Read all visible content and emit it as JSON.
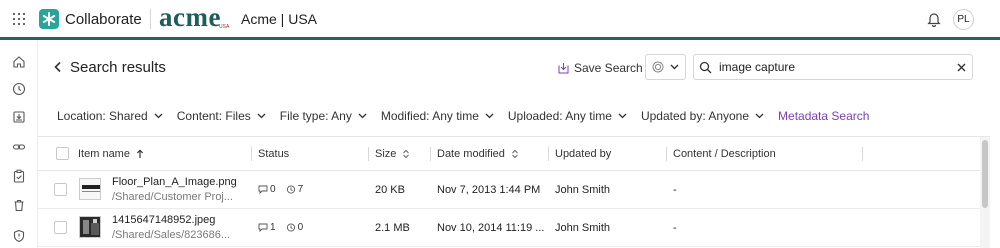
{
  "app": {
    "name": "Collaborate",
    "org_logo_text": "acme",
    "org_logo_sub": "USA",
    "org_name": "Acme | USA"
  },
  "user": {
    "initials": "PL"
  },
  "page": {
    "title": "Search results"
  },
  "toolbar": {
    "save_search_label": "Save Search"
  },
  "search": {
    "value": "image capture",
    "placeholder": ""
  },
  "filters": [
    {
      "label": "Location: Shared"
    },
    {
      "label": "Content: Files"
    },
    {
      "label": "File type: Any"
    },
    {
      "label": "Modified: Any time"
    },
    {
      "label": "Uploaded: Any time"
    },
    {
      "label": "Updated by: Anyone"
    }
  ],
  "metadata_search_label": "Metadata Search",
  "table": {
    "columns": {
      "name": "Item name",
      "status": "Status",
      "size": "Size",
      "modified": "Date modified",
      "updated_by": "Updated by",
      "content": "Content / Description"
    },
    "rows": [
      {
        "name": "Floor_Plan_A_Image.png",
        "path": "/Shared/Customer Proj...",
        "comments": "0",
        "versions": "7",
        "size": "20 KB",
        "modified": "Nov 7, 2013 1:44 PM",
        "updated_by": "John Smith",
        "content": "-"
      },
      {
        "name": "1415647148952.jpeg",
        "path": "/Shared/Sales/823686...",
        "comments": "1",
        "versions": "0",
        "size": "2.1 MB",
        "modified": "Nov 10, 2014 11:19 ...",
        "updated_by": "John Smith",
        "content": "-"
      }
    ]
  },
  "colors": {
    "accent_bar": "#28606a",
    "app_logo": "#2aa39a",
    "link": "#7b3fb5"
  }
}
